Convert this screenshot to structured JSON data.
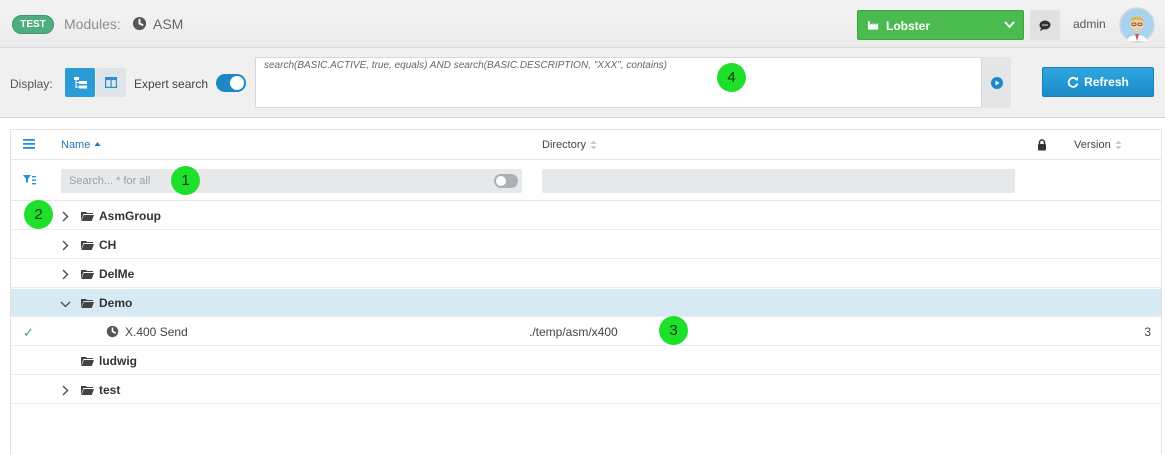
{
  "header": {
    "env_badge": "TEST",
    "modules_label": "Modules:",
    "module_name": "ASM",
    "environment": "Lobster",
    "user": "admin"
  },
  "toolbar": {
    "display_label": "Display:",
    "expert_search_label": "Expert search",
    "expert_search_on": true,
    "query": "search(BASIC.ACTIVE, true, equals) AND search(BASIC.DESCRIPTION, \"XXX\", contains)",
    "refresh_label": "Refresh"
  },
  "grid": {
    "columns": {
      "name": "Name",
      "directory": "Directory",
      "version": "Version"
    },
    "filter": {
      "name_placeholder": "Search... * for all"
    },
    "rows": [
      {
        "type": "folder",
        "label": "AsmGroup",
        "expanded": false
      },
      {
        "type": "folder",
        "label": "CH",
        "expanded": false
      },
      {
        "type": "folder",
        "label": "DelMe",
        "expanded": false
      },
      {
        "type": "folder",
        "label": "Demo",
        "expanded": true,
        "selected": true
      },
      {
        "type": "module",
        "label": "X.400 Send",
        "directory": "./temp/asm/x400",
        "version": "3",
        "active": true
      },
      {
        "type": "folder",
        "label": "ludwig",
        "expanded": false,
        "leaf": true
      },
      {
        "type": "folder",
        "label": "test",
        "expanded": false
      }
    ]
  },
  "markers": [
    "1",
    "2",
    "3",
    "4"
  ],
  "colors": {
    "accent": "#2a9bd4",
    "env_green": "#4cbb4f",
    "badge_green": "#4caf7d",
    "selected_row": "#d7eaf3",
    "marker": "#1ee02a"
  }
}
